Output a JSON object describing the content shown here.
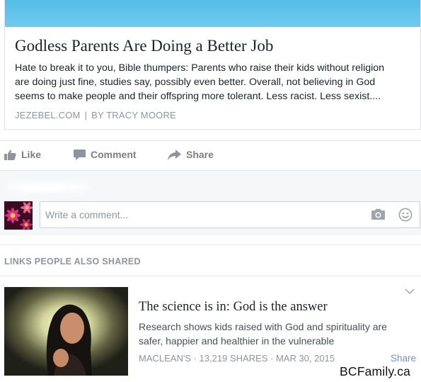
{
  "link_preview": {
    "title": "Godless Parents Are Doing a Better Job",
    "description": "Hate to break it to you, Bible thumpers: Parents who raise their kids without religion are doing just fine, studies say, possibly even better. Overall, not believing in God seems to make people and their offspring more tolerant. Less racist. Less sexist....",
    "source": "JEZEBEL.COM",
    "separator": "|",
    "byline": "BY TRACY MOORE"
  },
  "actions": {
    "like_label": "Like",
    "comment_label": "Comment",
    "share_label": "Share"
  },
  "comment_input": {
    "placeholder": "Write a comment..."
  },
  "related": {
    "heading": "LINKS PEOPLE ALSO SHARED",
    "items": [
      {
        "title": "The science is in: God is the answer",
        "description": "Research shows kids raised with God and spirituality are safer, happier and healthier in the vulnerable",
        "meta": "MACLEAN'S · 13,219 SHARES · MAR 30, 2015",
        "share_label": "Share"
      }
    ]
  },
  "watermark": "BCFamily.ca",
  "colors": {
    "link_banner": "#55bde7",
    "muted_text": "#90949c",
    "action_gray": "#7f7f7f",
    "share_link": "#7a8fbf"
  },
  "icons": [
    "thumbs-up-icon",
    "comment-icon",
    "share-arrow-icon",
    "camera-icon",
    "smiley-icon",
    "chevron-down-icon"
  ]
}
